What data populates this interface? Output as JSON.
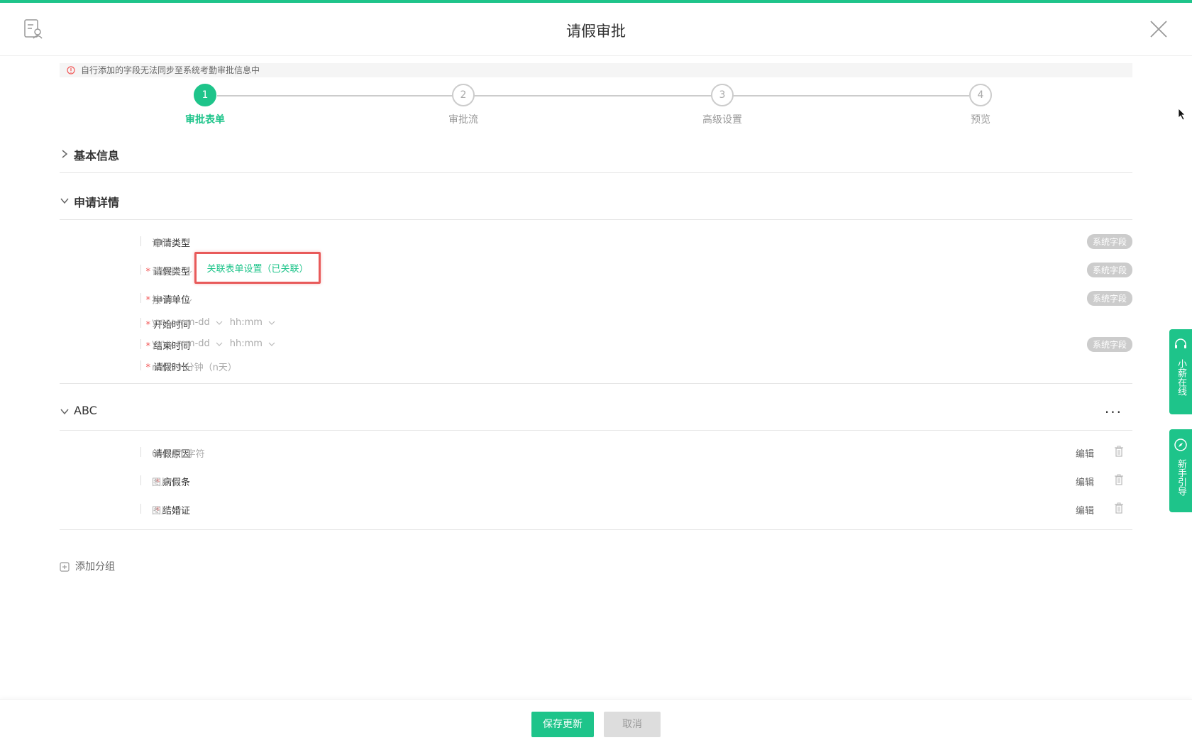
{
  "header": {
    "title": "请假审批"
  },
  "notice": {
    "text": "自行添加的字段无法同步至系统考勤审批信息中"
  },
  "steps": [
    {
      "num": "1",
      "label": "审批表单",
      "active": true
    },
    {
      "num": "2",
      "label": "审批流",
      "active": false
    },
    {
      "num": "3",
      "label": "高级设置",
      "active": false
    },
    {
      "num": "4",
      "label": "预览",
      "active": false
    }
  ],
  "sections": {
    "basic": {
      "title": "基本信息"
    },
    "details": {
      "title": "申请详情"
    },
    "abc": {
      "title": "ABC",
      "more": "···"
    }
  },
  "details_rows": [
    {
      "label": "申请类型",
      "required": false,
      "value": "请假",
      "badge": "系统字段"
    },
    {
      "label": "请假类型",
      "required": true,
      "value": "请选择",
      "badge": "系统字段"
    },
    {
      "label": "申请单位",
      "required": true,
      "value": "按小时",
      "badge": "系统字段"
    },
    {
      "label": "开始时间",
      "required": true,
      "date": "yyyy-mm-dd",
      "time": "hh:mm"
    },
    {
      "label": "结束时间",
      "required": true,
      "date": "yyyy-mm-dd",
      "time": "hh:mm",
      "badge": "系统字段"
    },
    {
      "label": "请假时长",
      "required": true,
      "value": "n小时 n分钟（n天）"
    }
  ],
  "linked_form": {
    "label": "关联表单设置（已关联）"
  },
  "abc_rows": [
    {
      "label": "请假原因",
      "required": false,
      "value": "0~20个字符",
      "edit": "编辑"
    },
    {
      "label": "病假条",
      "required": true,
      "value": "图片",
      "edit": "编辑"
    },
    {
      "label": "结婚证",
      "required": true,
      "value": "图片",
      "edit": "编辑"
    }
  ],
  "add_group": {
    "label": "添加分组"
  },
  "footer": {
    "save": "保存更新",
    "cancel": "取消"
  },
  "side": {
    "online": {
      "text": "小薪在线"
    },
    "guide": {
      "text": "新手引导"
    }
  },
  "required_mark": "*",
  "colors": {
    "accent": "#1ec48a",
    "required": "#f25757",
    "highlight": "#e85a5a"
  }
}
